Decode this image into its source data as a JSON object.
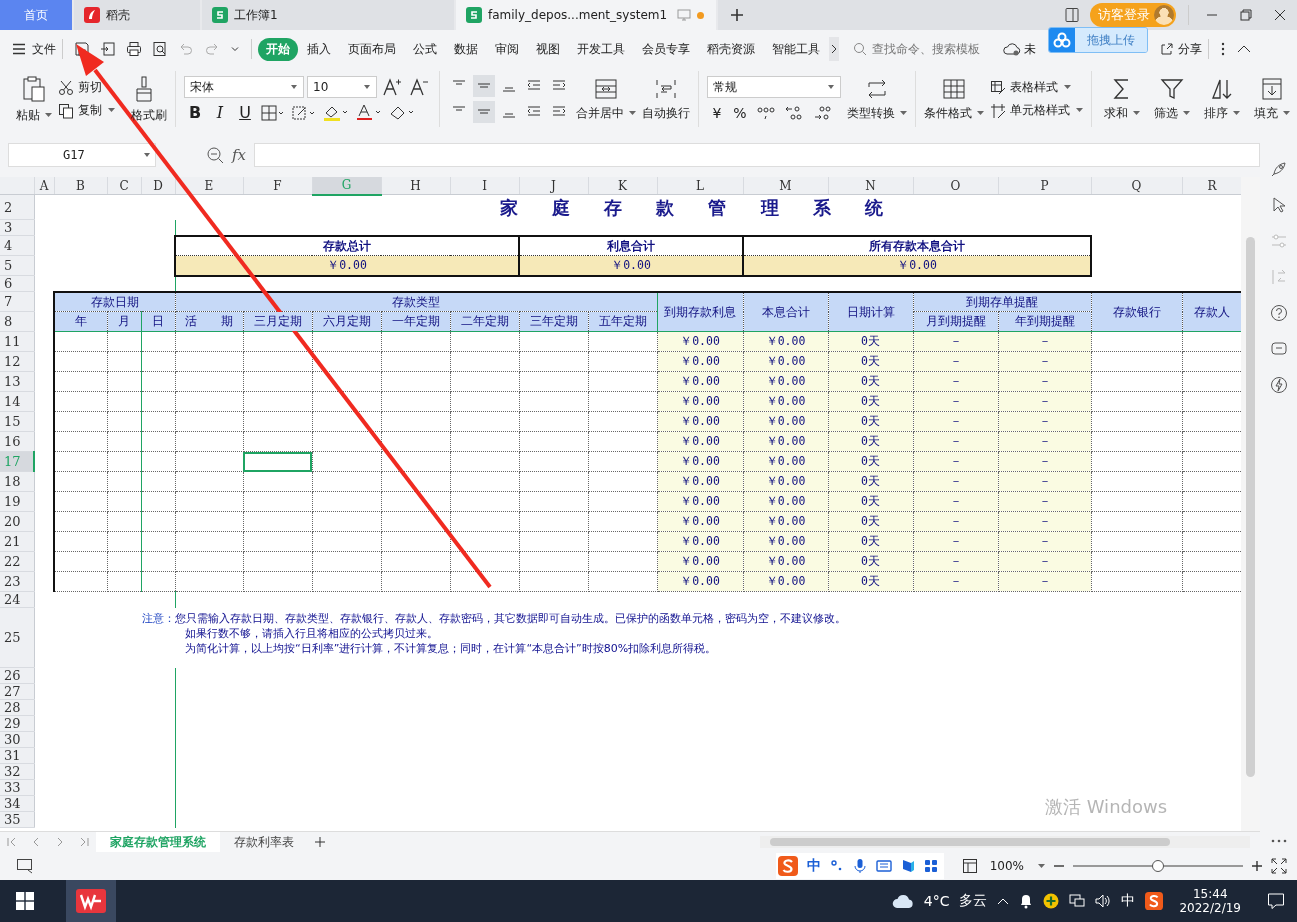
{
  "browser_tabs": [
    {
      "label": "首页",
      "kind": "home",
      "selected": false
    },
    {
      "label": "稻壳",
      "kind": "docer",
      "selected": false
    },
    {
      "label": "工作簿1",
      "kind": "sheet",
      "selected": false
    },
    {
      "label": "family_depos...ment_system1",
      "kind": "sheet",
      "selected": true
    }
  ],
  "login_button": "访客登录",
  "file_menu": "文件",
  "menu": [
    {
      "label": "开始",
      "selected": true
    },
    {
      "label": "插入",
      "selected": false
    },
    {
      "label": "页面布局",
      "selected": false
    },
    {
      "label": "公式",
      "selected": false
    },
    {
      "label": "数据",
      "selected": false
    },
    {
      "label": "审阅",
      "selected": false
    },
    {
      "label": "视图",
      "selected": false
    },
    {
      "label": "开发工具",
      "selected": false
    },
    {
      "label": "会员专享",
      "selected": false
    },
    {
      "label": "稻壳资源",
      "selected": false
    },
    {
      "label": "智能工具",
      "selected": false
    }
  ],
  "search": {
    "placeholder": "查找命令、搜索模板"
  },
  "cloud_status": "未",
  "upload_popup": "拖拽上传",
  "share_button": "分享",
  "ribbon": {
    "paste": "粘贴",
    "cut": "剪切",
    "copy": "复制",
    "format_painter": "格式刷",
    "font": "宋体",
    "font_size": "10",
    "text_styles": [
      "B",
      "I",
      "U"
    ],
    "merge": "合并居中",
    "wrap": "自动换行",
    "number_format": "常规",
    "number_buttons": [
      "¥",
      "%"
    ],
    "convert": "类型转换",
    "conditional_format": "条件格式",
    "table_style": "表格样式",
    "cell_style": "单元格样式",
    "editing": [
      "求和",
      "筛选",
      "排序",
      "填充"
    ]
  },
  "name_box": "G17",
  "formula_label": "fx",
  "sheet": {
    "columns": [
      {
        "label": "A",
        "selected": false
      },
      {
        "label": "B",
        "selected": false
      },
      {
        "label": "C",
        "selected": false
      },
      {
        "label": "D",
        "selected": false
      },
      {
        "label": "E",
        "selected": false
      },
      {
        "label": "F",
        "selected": false
      },
      {
        "label": "G",
        "selected": true
      },
      {
        "label": "H",
        "selected": false
      },
      {
        "label": "I",
        "selected": false
      },
      {
        "label": "J",
        "selected": false
      },
      {
        "label": "K",
        "selected": false
      },
      {
        "label": "L",
        "selected": false
      },
      {
        "label": "M",
        "selected": false
      },
      {
        "label": "N",
        "selected": false
      },
      {
        "label": "O",
        "selected": false
      },
      {
        "label": "P",
        "selected": false
      },
      {
        "label": "Q",
        "selected": false
      },
      {
        "label": "R",
        "selected": false
      }
    ],
    "rows": [
      {
        "label": "2",
        "selected": false,
        "kind": "title",
        "title": "家庭存款管理系统"
      },
      {
        "label": "3",
        "selected": false,
        "kind": "blank"
      },
      {
        "label": "4",
        "selected": false,
        "kind": "summary_labels",
        "cells": [
          "存款总计",
          "利息合计",
          "所有存款本息合计"
        ]
      },
      {
        "label": "5",
        "selected": false,
        "kind": "summary_values",
        "cells": [
          "￥0.00",
          "￥0.00",
          "￥0.00"
        ]
      },
      {
        "label": "6",
        "selected": false,
        "kind": "blank"
      },
      {
        "label": "7",
        "selected": false,
        "kind": "header_top",
        "cells": [
          "存款日期",
          "存款类型",
          "到期存款利息",
          "本息合计",
          "日期计算",
          "到期存单提醒",
          "存款银行",
          "存款人"
        ]
      },
      {
        "label": "8",
        "selected": false,
        "kind": "header_bottom",
        "cells": [
          "年",
          "月",
          "日",
          "活　　期",
          "三月定期",
          "六月定期",
          "一年定期",
          "二年定期",
          "三年定期",
          "五年定期",
          "月到期提醒",
          "年到期提醒"
        ]
      },
      {
        "label": "11",
        "selected": false,
        "kind": "data",
        "cells": [
          "￥0.00",
          "￥0.00",
          "0天",
          "－",
          "－"
        ]
      },
      {
        "label": "12",
        "selected": false,
        "kind": "data",
        "cells": [
          "￥0.00",
          "￥0.00",
          "0天",
          "－",
          "－"
        ]
      },
      {
        "label": "13",
        "selected": false,
        "kind": "data",
        "cells": [
          "￥0.00",
          "￥0.00",
          "0天",
          "－",
          "－"
        ]
      },
      {
        "label": "14",
        "selected": false,
        "kind": "data",
        "cells": [
          "￥0.00",
          "￥0.00",
          "0天",
          "－",
          "－"
        ]
      },
      {
        "label": "15",
        "selected": false,
        "kind": "data",
        "cells": [
          "￥0.00",
          "￥0.00",
          "0天",
          "－",
          "－"
        ]
      },
      {
        "label": "16",
        "selected": false,
        "kind": "data",
        "cells": [
          "￥0.00",
          "￥0.00",
          "0天",
          "－",
          "－"
        ]
      },
      {
        "label": "17",
        "selected": true,
        "kind": "data",
        "cells": [
          "￥0.00",
          "￥0.00",
          "0天",
          "－",
          "－"
        ]
      },
      {
        "label": "18",
        "selected": false,
        "kind": "data",
        "cells": [
          "￥0.00",
          "￥0.00",
          "0天",
          "－",
          "－"
        ]
      },
      {
        "label": "19",
        "selected": false,
        "kind": "data",
        "cells": [
          "￥0.00",
          "￥0.00",
          "0天",
          "－",
          "－"
        ]
      },
      {
        "label": "20",
        "selected": false,
        "kind": "data",
        "cells": [
          "￥0.00",
          "￥0.00",
          "0天",
          "－",
          "－"
        ]
      },
      {
        "label": "21",
        "selected": false,
        "kind": "data",
        "cells": [
          "￥0.00",
          "￥0.00",
          "0天",
          "－",
          "－"
        ]
      },
      {
        "label": "22",
        "selected": false,
        "kind": "data",
        "cells": [
          "￥0.00",
          "￥0.00",
          "0天",
          "－",
          "－"
        ]
      },
      {
        "label": "23",
        "selected": false,
        "kind": "data",
        "cells": [
          "￥0.00",
          "￥0.00",
          "0天",
          "－",
          "－"
        ]
      },
      {
        "label": "24",
        "selected": false,
        "kind": "blank"
      },
      {
        "label": "25",
        "selected": false,
        "kind": "note",
        "note_label": "注意：",
        "lines": [
          "您只需输入存款日期、存款类型、存款银行、存款人、存款密码，其它数据即可自动生成。已保护的函数单元格，密码为空，不建议修改。",
          "如果行数不够，请插入行且将相应的公式拷贝过来。",
          "为简化计算，以上均按“日利率”进行计算，不计算复息；同时，在计算“本息合计”时按80%扣除利息所得税。"
        ]
      },
      {
        "label": "26",
        "selected": false,
        "kind": "blank"
      },
      {
        "label": "27",
        "selected": false,
        "kind": "blank"
      },
      {
        "label": "28",
        "selected": false,
        "kind": "blank"
      },
      {
        "label": "29",
        "selected": false,
        "kind": "blank"
      },
      {
        "label": "30",
        "selected": false,
        "kind": "blank"
      },
      {
        "label": "31",
        "selected": false,
        "kind": "blank"
      },
      {
        "label": "32",
        "selected": false,
        "kind": "blank"
      },
      {
        "label": "33",
        "selected": false,
        "kind": "blank"
      },
      {
        "label": "34",
        "selected": false,
        "kind": "blank"
      },
      {
        "label": "35",
        "selected": false,
        "kind": "blank"
      }
    ]
  },
  "sheet_tabs": [
    {
      "label": "家庭存款管理系统",
      "selected": true
    },
    {
      "label": "存款利率表",
      "selected": false
    }
  ],
  "status_bar": {
    "ime_mode": "中",
    "zoom": "100%",
    "zoom_slider": {
      "level": 0.5
    }
  },
  "os_notice": "激活 Windows",
  "taskbar": {
    "temperature": "4°C",
    "weather": "多云",
    "ime": "中",
    "time": "15:44",
    "date": "2022/2/19"
  }
}
